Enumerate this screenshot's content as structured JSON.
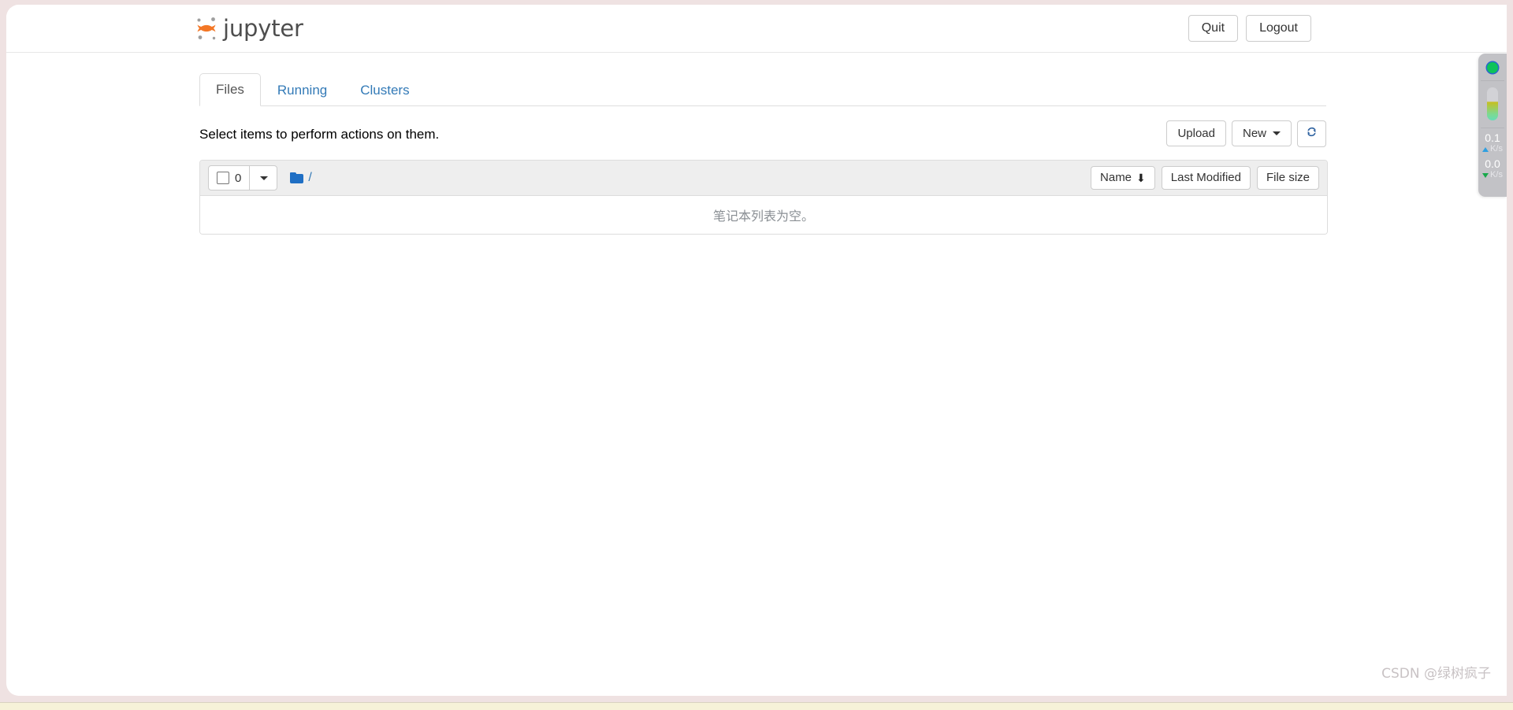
{
  "header": {
    "logo_text": "jupyter",
    "logo_icon": "jupyter-logo-icon",
    "quit_label": "Quit",
    "logout_label": "Logout"
  },
  "tabs": [
    {
      "label": "Files",
      "active": true
    },
    {
      "label": "Running",
      "active": false
    },
    {
      "label": "Clusters",
      "active": false
    }
  ],
  "toolbar": {
    "select_hint": "Select items to perform actions on them.",
    "upload_label": "Upload",
    "new_label": "New",
    "refresh_icon": "refresh-icon"
  },
  "filelist": {
    "select_count": "0",
    "breadcrumb_root": "/",
    "folder_icon": "folder-icon",
    "sort_name_label": "Name",
    "sort_name_direction_icon": "arrow-down-icon",
    "sort_modified_label": "Last Modified",
    "sort_size_label": "File size",
    "empty_message": "笔记本列表为空。"
  },
  "net_widget": {
    "status_icon": "green-status-dot-icon",
    "capsule_icon": "battery-capsule-icon",
    "upload_value": "0.1",
    "upload_unit": "K/s",
    "upload_icon": "arrow-up-icon",
    "download_value": "0.0",
    "download_unit": "K/s",
    "download_icon": "arrow-down-icon"
  },
  "watermark": {
    "text": "CSDN @绿树疯子"
  },
  "colors": {
    "brand_orange": "#f37726",
    "link_blue": "#337ab7",
    "frame_pink": "#efe2e2",
    "toolbar_gray": "#eeeeee",
    "status_green": "#0ec35a"
  }
}
